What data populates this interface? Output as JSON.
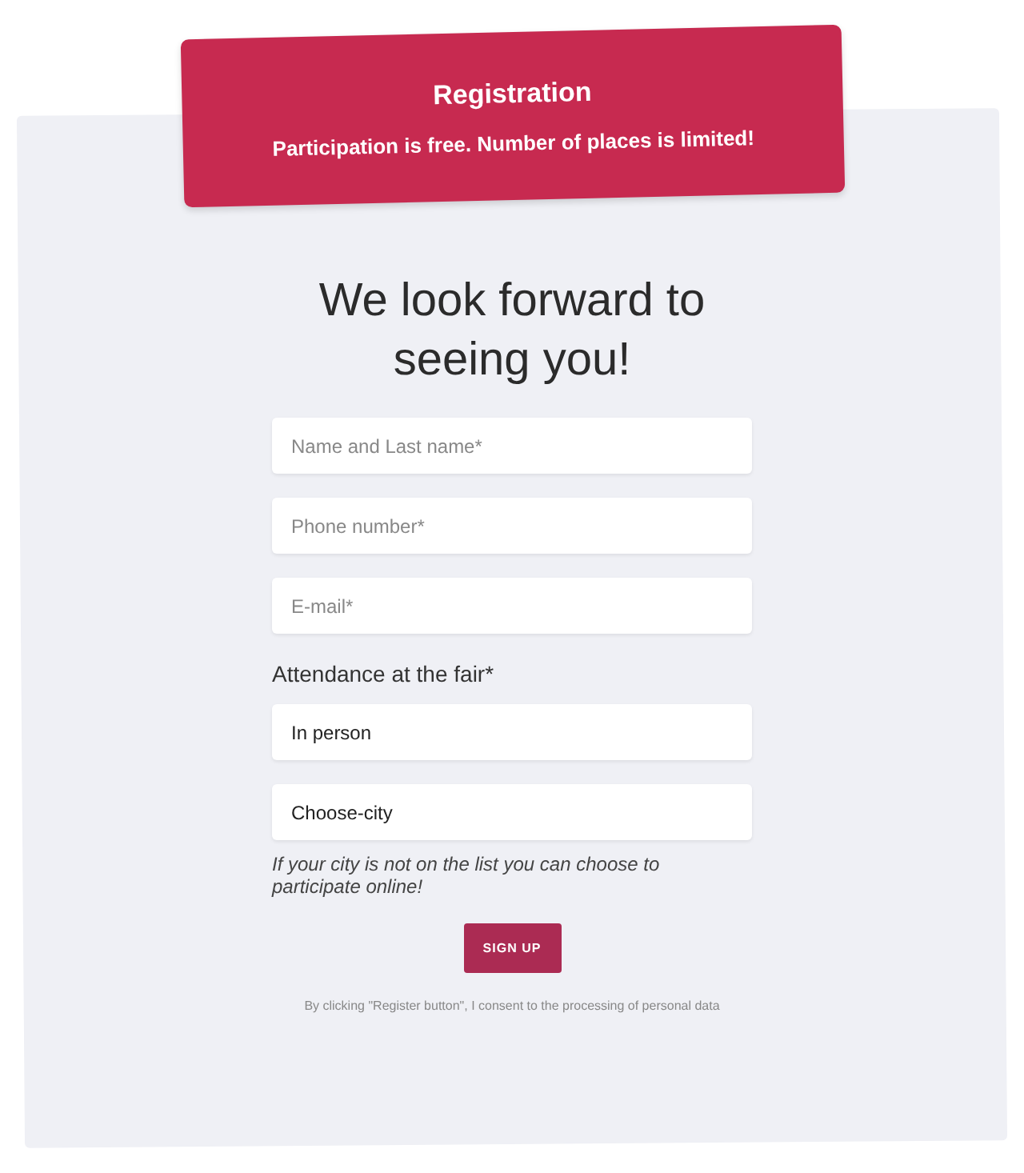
{
  "banner": {
    "title": "Registration",
    "subtitle": "Participation is free. Number of places is limited!"
  },
  "heading": "We look forward to seeing you!",
  "fields": [
    {
      "placeholder": "Name and Last name*"
    },
    {
      "placeholder": "Phone number*"
    },
    {
      "placeholder": "E-mail*"
    }
  ],
  "attendance": {
    "label": "Attendance at the fair*",
    "mode": "In person",
    "city": "Choose-city",
    "note": "If your city is not on the list you can choose to participate online!"
  },
  "submit": "SIGN UP",
  "consent": "By clicking \"Register button\", I consent to the processing of personal data"
}
